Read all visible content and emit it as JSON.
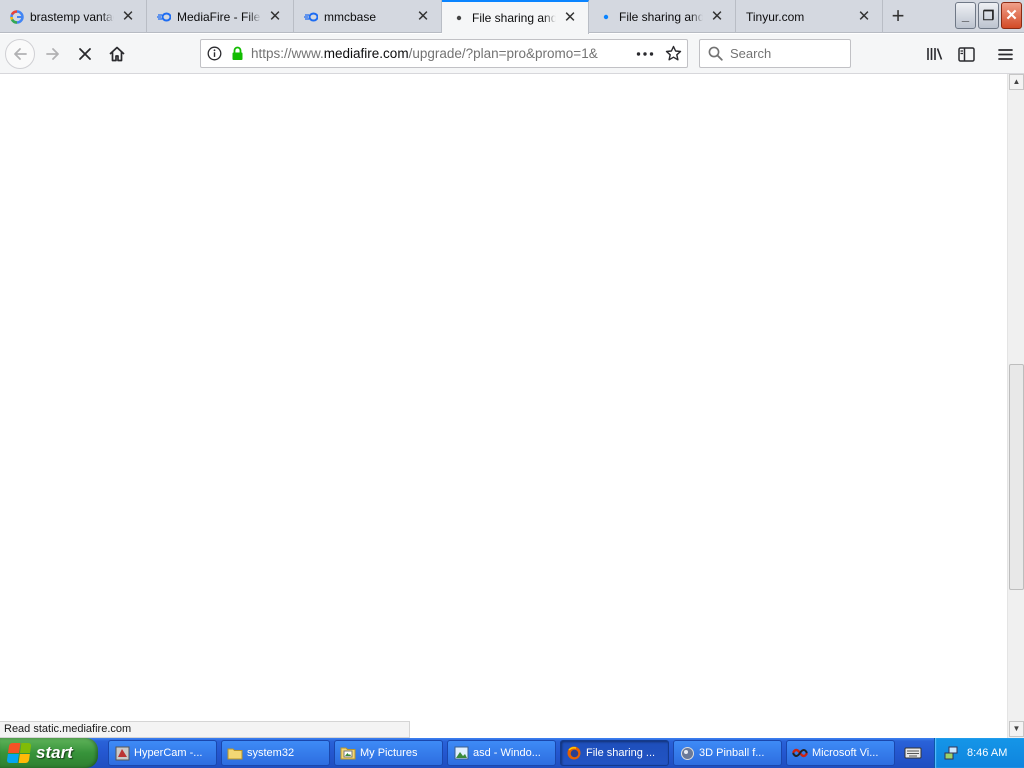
{
  "browser": {
    "tabs": [
      {
        "title": "brastemp vantage",
        "icon": "google-icon",
        "active": false
      },
      {
        "title": "MediaFire - File sh",
        "icon": "mediafire-icon",
        "active": false
      },
      {
        "title": "mmcbase",
        "icon": "mediafire-icon",
        "active": false
      },
      {
        "title": "File sharing and st",
        "icon": "loading-dot-icon",
        "active": true
      },
      {
        "title": "File sharing and st",
        "icon": "loading-dot-icon",
        "active": false
      },
      {
        "title": "Tinyur.com",
        "icon": "none",
        "active": false
      }
    ],
    "new_tab_label": "+",
    "close_glyph": "✕",
    "url": {
      "prefix": "https://www.",
      "host": "mediafire.com",
      "path": "/upgrade/?plan=pro&promo=1&"
    },
    "search_placeholder": "Search",
    "status_text": "Read static.mediafire.com",
    "accent_color": "#0a84ff"
  },
  "window_controls": {
    "minimize": "_",
    "restore": "❐",
    "close": "✕"
  },
  "taskbar": {
    "start_label": "start",
    "tasks": [
      {
        "label": "HyperCam -...",
        "icon": "hypercam-icon",
        "active": false
      },
      {
        "label": "system32",
        "icon": "folder-icon",
        "active": false
      },
      {
        "label": "My Pictures",
        "icon": "folder-pictures-icon",
        "active": false
      },
      {
        "label": "asd - Windo...",
        "icon": "image-viewer-icon",
        "active": false
      },
      {
        "label": "File sharing ...",
        "icon": "firefox-icon",
        "active": true
      },
      {
        "label": "3D Pinball f...",
        "icon": "pinball-icon",
        "active": false
      },
      {
        "label": "Microsoft Vi...",
        "icon": "visual-studio-icon",
        "active": false
      }
    ],
    "clock": "8:46 AM"
  }
}
